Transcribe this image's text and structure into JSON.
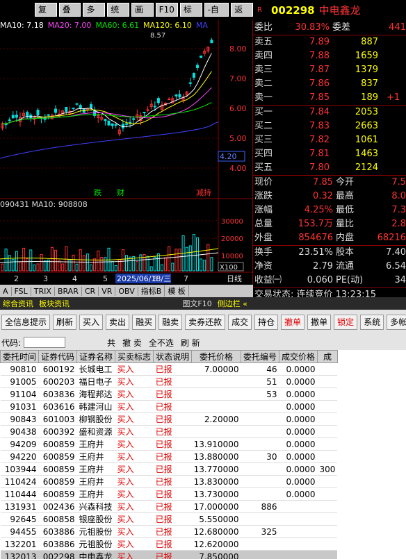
{
  "topbar": {
    "buttons": [
      "复权",
      "叠加",
      "多股",
      "统计",
      "画线",
      "F10",
      "标记",
      "-自选",
      "返回"
    ]
  },
  "chart": {
    "ma": [
      {
        "label": "MA10: 7.18",
        "color": "#ffffff"
      },
      {
        "label": "MA20: 7.00",
        "color": "#ff44ff"
      },
      {
        "label": "MA60: 6.61",
        "color": "#00e600"
      },
      {
        "label": "MA120: 6.10",
        "color": "#ffff00"
      },
      {
        "label": "MA",
        "color": "#4040ff"
      }
    ],
    "y_ticks": [
      "8.00",
      "7.00",
      "6.00",
      "5.00",
      "4.00"
    ],
    "high_label": "8.57",
    "price_tag": "4.20",
    "markers": [
      "跌",
      "财",
      "减持"
    ],
    "vol_label": "090431  MA10: 908808",
    "vol_ticks": [
      "30000",
      "20000",
      "10000"
    ],
    "vol_unit": "X100",
    "date_label": "2025/06/18/三",
    "date_nums": [
      "2",
      "3",
      "4",
      "5",
      "6",
      "7"
    ],
    "period": "日线"
  },
  "bottom_tabs": [
    "A",
    "FSL",
    "TRIX",
    "BRAR",
    "CR",
    "VR",
    "OBV",
    "指标B",
    "模 板"
  ],
  "news_tabs": [
    "综合资讯",
    "板块资讯",
    "图文F10",
    "侧边栏 «"
  ],
  "quote": {
    "code": "002298",
    "name": "中电鑫龙",
    "wei_bi": "30.83%",
    "wei_cha": "441",
    "sell": [
      {
        "l": "卖五",
        "p": "7.89",
        "v": "887"
      },
      {
        "l": "卖四",
        "p": "7.88",
        "v": "1659"
      },
      {
        "l": "卖三",
        "p": "7.87",
        "v": "1379"
      },
      {
        "l": "卖二",
        "p": "7.86",
        "v": "837"
      },
      {
        "l": "卖一",
        "p": "7.85",
        "v": "189",
        "c": "+1"
      }
    ],
    "buy": [
      {
        "l": "买一",
        "p": "7.84",
        "v": "2053"
      },
      {
        "l": "买二",
        "p": "7.83",
        "v": "2663"
      },
      {
        "l": "买三",
        "p": "7.82",
        "v": "1061"
      },
      {
        "l": "买四",
        "p": "7.81",
        "v": "1463"
      },
      {
        "l": "买五",
        "p": "7.80",
        "v": "2124"
      }
    ],
    "stats": [
      {
        "a": "现价",
        "av": "7.85",
        "b": "今开",
        "bv": "7.5"
      },
      {
        "a": "涨跌",
        "av": "0.32",
        "b": "最高",
        "bv": "8.0"
      },
      {
        "a": "涨幅",
        "av": "4.25%",
        "b": "最低",
        "bv": "7.3"
      },
      {
        "a": "总量",
        "av": "153.7万",
        "b": "量比",
        "bv": "2.8"
      },
      {
        "a": "外盘",
        "av": "854676",
        "b": "内盘",
        "bv": "68216"
      }
    ],
    "stats2": [
      {
        "a": "换手",
        "av": "23.51%",
        "b": "股本",
        "bv": "7.40"
      },
      {
        "a": "净资",
        "av": "2.79",
        "b": "流通",
        "bv": "6.54"
      },
      {
        "a": "收益㈠",
        "av": "0.060",
        "b": "PE(动)",
        "bv": "34"
      }
    ],
    "status": "交易状态: 连续竞价 13:23:15",
    "rtabs": [
      "笔",
      "价",
      "细",
      "势",
      "联",
      "值",
      "主",
      "筹"
    ]
  },
  "toolbar": {
    "buttons": [
      "全信息提示",
      "刷新",
      "买入",
      "卖出",
      "融买",
      "融卖",
      "卖券还款",
      "成交",
      "持仓",
      "撤单",
      "撤单",
      "锁定",
      "系统",
      "多帐号"
    ]
  },
  "filter": {
    "code_label": "代码:",
    "items": [
      "共",
      "撤 卖",
      "全不选",
      "刷 新"
    ]
  },
  "table": {
    "headers": [
      "委托时间",
      "证券代码",
      "证券名称",
      "买卖标志",
      "状态说明",
      "委托价格",
      "委托编号",
      "成交价格",
      "成"
    ],
    "rows": [
      [
        "90810",
        "600192",
        "长城电工",
        "买入",
        "已报",
        "7.00000",
        "46",
        "0.0000",
        ""
      ],
      [
        "91005",
        "600203",
        "福日电子",
        "买入",
        "已报",
        "",
        "51",
        "0.0000",
        ""
      ],
      [
        "91104",
        "603836",
        "海程邦达",
        "买入",
        "已报",
        "",
        "53",
        "0.0000",
        ""
      ],
      [
        "91031",
        "603616",
        "韩建河山",
        "买入",
        "已报",
        "",
        "",
        "0.0000",
        ""
      ],
      [
        "90843",
        "601003",
        "柳钢股份",
        "买入",
        "已报",
        "2.20000",
        "",
        "0.0000",
        ""
      ],
      [
        "90438",
        "600392",
        "盛和资源",
        "买入",
        "已报",
        "",
        "",
        "0.0000",
        ""
      ],
      [
        "94209",
        "600859",
        "王府井",
        "买入",
        "已报",
        "13.910000",
        "",
        "0.0000",
        ""
      ],
      [
        "94220",
        "600859",
        "王府井",
        "买入",
        "已报",
        "13.880000",
        "30",
        "0.0000",
        ""
      ],
      [
        "103944",
        "600859",
        "王府井",
        "买入",
        "已报",
        "13.770000",
        "",
        "0.0000",
        "300"
      ],
      [
        "110424",
        "600859",
        "王府井",
        "买入",
        "已报",
        "13.830000",
        "",
        "0.0000",
        ""
      ],
      [
        "110444",
        "600859",
        "王府井",
        "买入",
        "已报",
        "13.730000",
        "",
        "0.0000",
        ""
      ],
      [
        "131931",
        "002436",
        "兴森科技",
        "买入",
        "已报",
        "17.000000",
        "886",
        "",
        ""
      ],
      [
        "92645",
        "600858",
        "银座股份",
        "买入",
        "已报",
        "5.550000",
        "",
        "",
        ""
      ],
      [
        "94455",
        "603886",
        "元祖股份",
        "买入",
        "已报",
        "12.680000",
        "325",
        "",
        ""
      ],
      [
        "132201",
        "603886",
        "元祖股份",
        "买入",
        "已报",
        "12.620000",
        "",
        "",
        ""
      ],
      [
        "132013",
        "002298",
        "中电鑫龙",
        "买入",
        "已报",
        "7.850000",
        "",
        "",
        ""
      ]
    ]
  }
}
